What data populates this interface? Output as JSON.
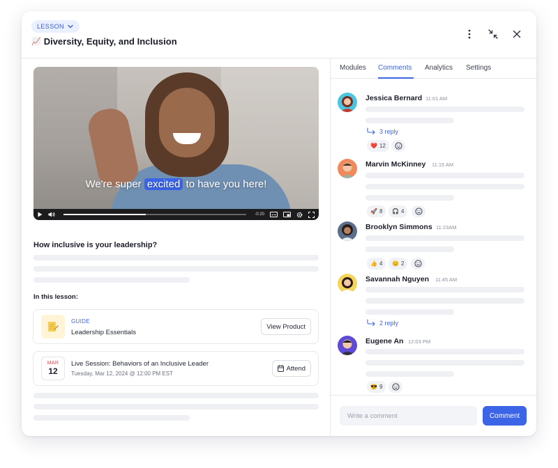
{
  "header": {
    "kicker": "LESSON",
    "title_emoji": "📈",
    "title": "Diversity, Equity, and Inclusion"
  },
  "video": {
    "caption_before": "We're super",
    "caption_highlight": "excited",
    "caption_after": "to have you here!",
    "time_remaining": "-0:20",
    "progress": 0.45
  },
  "lesson": {
    "question": "How inclusive is your leadership?",
    "in_lesson_label": "In this lesson:",
    "guide": {
      "kicker": "GUIDE",
      "name": "Leadership Essentials",
      "button": "View Product"
    },
    "session": {
      "month": "MAR",
      "day": "12",
      "name": "Live Session: Behaviors of an Inclusive Leader",
      "time": "Tuesday, Mar 12, 2024 @ 12:00 PM EST",
      "button": "Attend"
    }
  },
  "tabs": [
    "Modules",
    "Comments",
    "Analytics",
    "Settings"
  ],
  "active_tab": "Comments",
  "comments": [
    {
      "name": "Jessica Bernard",
      "time": "11:01 AM",
      "reply": "3 reply",
      "reactions": [
        {
          "emoji": "❤️",
          "count": "12"
        }
      ]
    },
    {
      "name": "Marvin McKinney",
      "time": "11:15 AM",
      "reply": "",
      "reactions": [
        {
          "emoji": "🚀",
          "count": "8"
        },
        {
          "emoji": "🎧",
          "count": "4"
        }
      ]
    },
    {
      "name": "Brooklyn Simmons",
      "time": "11:23AM",
      "reply": "",
      "reactions": [
        {
          "emoji": "👍",
          "count": "4"
        },
        {
          "emoji": "😊",
          "count": "2"
        }
      ]
    },
    {
      "name": "Savannah Nguyen",
      "time": "11:45 AM",
      "reply": "2 reply",
      "reactions": []
    },
    {
      "name": "Eugene An",
      "time": "12:03 PM",
      "reply": "",
      "reactions": [
        {
          "emoji": "😎",
          "count": "9"
        }
      ]
    }
  ],
  "composer": {
    "placeholder": "Write a comment",
    "button": "Comment"
  },
  "colors": {
    "accent": "#3b64e6",
    "accent_soft": "#eaf0fe",
    "date_red": "#e5484d"
  }
}
